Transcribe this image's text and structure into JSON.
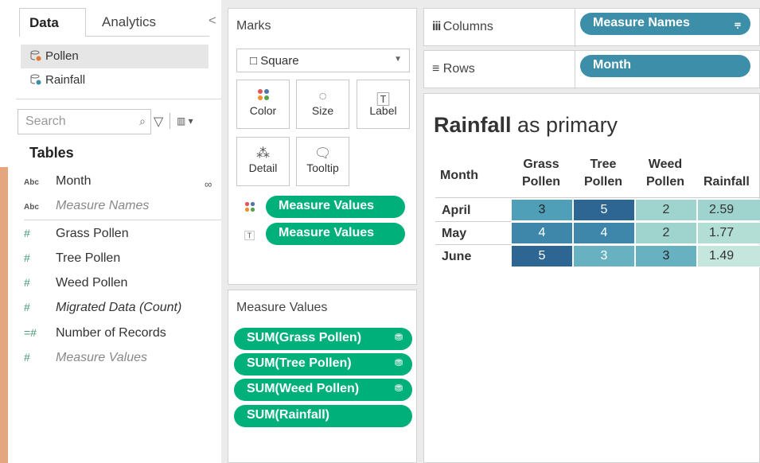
{
  "left_pane": {
    "tabs": [
      {
        "label": "Data"
      },
      {
        "label": "Analytics"
      }
    ],
    "collapse_glyph": "<",
    "datasources": [
      {
        "label": "Pollen"
      },
      {
        "label": "Rainfall"
      }
    ],
    "search_placeholder": "Search",
    "tables_heading": "Tables",
    "fields": [
      {
        "type": "Abc",
        "label": "Month"
      },
      {
        "type": "Abc",
        "label": "Measure Names"
      },
      {
        "type": "#",
        "label": "Grass Pollen"
      },
      {
        "type": "#",
        "label": "Tree Pollen"
      },
      {
        "type": "#",
        "label": "Weed Pollen"
      },
      {
        "type": "#",
        "label": "Migrated Data (Count)"
      },
      {
        "type": "=#",
        "label": "Number of Records"
      },
      {
        "type": "#",
        "label": "Measure Values"
      }
    ]
  },
  "marks": {
    "title": "Marks",
    "mark_type": "Square",
    "buttons": [
      {
        "label": "Color"
      },
      {
        "label": "Size"
      },
      {
        "label": "Label"
      },
      {
        "label": "Detail"
      },
      {
        "label": "Tooltip"
      }
    ],
    "pills": [
      {
        "label": "Measure Values"
      },
      {
        "label": "Measure Values"
      }
    ]
  },
  "measure_values": {
    "title": "Measure Values",
    "pills": [
      {
        "label": "SUM(Grass Pollen)"
      },
      {
        "label": "SUM(Tree Pollen)"
      },
      {
        "label": "SUM(Weed Pollen)"
      },
      {
        "label": "SUM(Rainfall)"
      }
    ]
  },
  "shelves": {
    "columns_label": "Columns",
    "columns_pill": "Measure Names",
    "rows_label": "Rows",
    "rows_pill": "Month"
  },
  "view": {
    "title_bold": "Rainfall",
    "title_rest": " as primary",
    "row_header": "Month",
    "columns": [
      {
        "line1": "Grass",
        "line2": "Pollen"
      },
      {
        "line1": "Tree",
        "line2": "Pollen"
      },
      {
        "line1": "Weed",
        "line2": "Pollen"
      },
      {
        "line1": "",
        "line2": "Rainfall"
      }
    ],
    "rows": [
      {
        "label": "April",
        "values": [
          "3",
          "5",
          "2",
          "2.59"
        ]
      },
      {
        "label": "May",
        "values": [
          "4",
          "4",
          "2",
          "1.77"
        ]
      },
      {
        "label": "June",
        "values": [
          "5",
          "3",
          "3",
          "1.49"
        ]
      }
    ],
    "cell_colors": [
      [
        "#4f9fb9",
        "#2d6593",
        "#9fd3cd",
        "#9fd3cd"
      ],
      [
        "#3f86ab",
        "#3f86ab",
        "#9fd3cd",
        "#b3ded5"
      ],
      [
        "#2d6593",
        "#68b1c1",
        "#68b1c1",
        "#c5e6dc"
      ]
    ],
    "cell_text_colors": [
      [
        "#222",
        "#fff",
        "#333",
        "#333"
      ],
      [
        "#fff",
        "#fff",
        "#333",
        "#333"
      ],
      [
        "#fff",
        "#fff",
        "#222",
        "#333"
      ]
    ]
  }
}
